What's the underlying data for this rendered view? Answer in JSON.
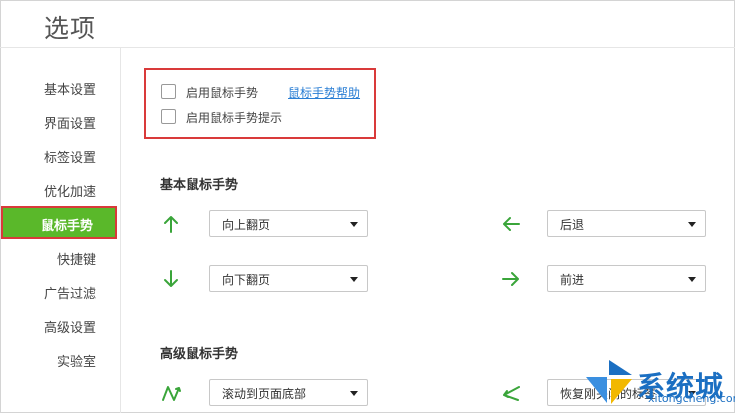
{
  "window": {
    "title": "选项"
  },
  "sidebar": {
    "items": [
      {
        "label": "基本设置"
      },
      {
        "label": "界面设置"
      },
      {
        "label": "标签设置"
      },
      {
        "label": "优化加速"
      },
      {
        "label": "鼠标手势",
        "active": true
      },
      {
        "label": "快捷键"
      },
      {
        "label": "广告过滤"
      },
      {
        "label": "高级设置"
      },
      {
        "label": "实验室"
      }
    ]
  },
  "options": {
    "enable_gesture": {
      "label": "启用鼠标手势",
      "checked": false
    },
    "help_link": "鼠标手势帮助",
    "enable_gesture_hint": {
      "label": "启用鼠标手势提示",
      "checked": false
    }
  },
  "basic": {
    "title": "基本鼠标手势",
    "gestures": {
      "up": {
        "icon": "arrow-up-icon",
        "value": "向上翻页"
      },
      "left": {
        "icon": "arrow-left-icon",
        "value": "后退"
      },
      "down": {
        "icon": "arrow-down-icon",
        "value": "向下翻页"
      },
      "right": {
        "icon": "arrow-right-icon",
        "value": "前进"
      }
    }
  },
  "advanced": {
    "title": "高级鼠标手势",
    "gestures": {
      "zigzag": {
        "icon": "gesture-zigzag-icon",
        "value": "滚动到页面底部"
      },
      "back_turn": {
        "icon": "gesture-turn-icon",
        "value": "恢复刚关闭的标签"
      }
    }
  },
  "watermark": {
    "text": "系统城",
    "sub": "xitongcheng.com"
  },
  "colors": {
    "accent": "#5ab82a",
    "highlight": "#d93a3a",
    "arrow": "#3aa53a",
    "link": "#2a7ed4"
  }
}
